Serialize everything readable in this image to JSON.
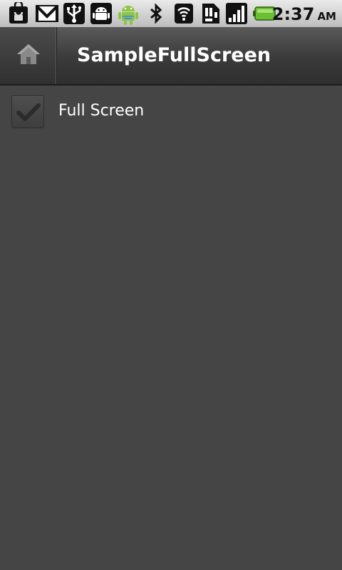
{
  "status_bar": {
    "time": "2:37",
    "ampm": "AM",
    "icons": [
      "market-bag-icon",
      "gmail-icon",
      "usb-icon",
      "android-debug-icon",
      "android-notification-icon",
      "bluetooth-icon",
      "wifi-icon",
      "sim-card-icon",
      "signal-icon",
      "battery-icon"
    ],
    "battery_color": "#7ac943"
  },
  "action_bar": {
    "title": "SampleFullScreen",
    "home_icon": "home-icon"
  },
  "preferences": [
    {
      "label": "Full Screen",
      "checked": true
    }
  ]
}
